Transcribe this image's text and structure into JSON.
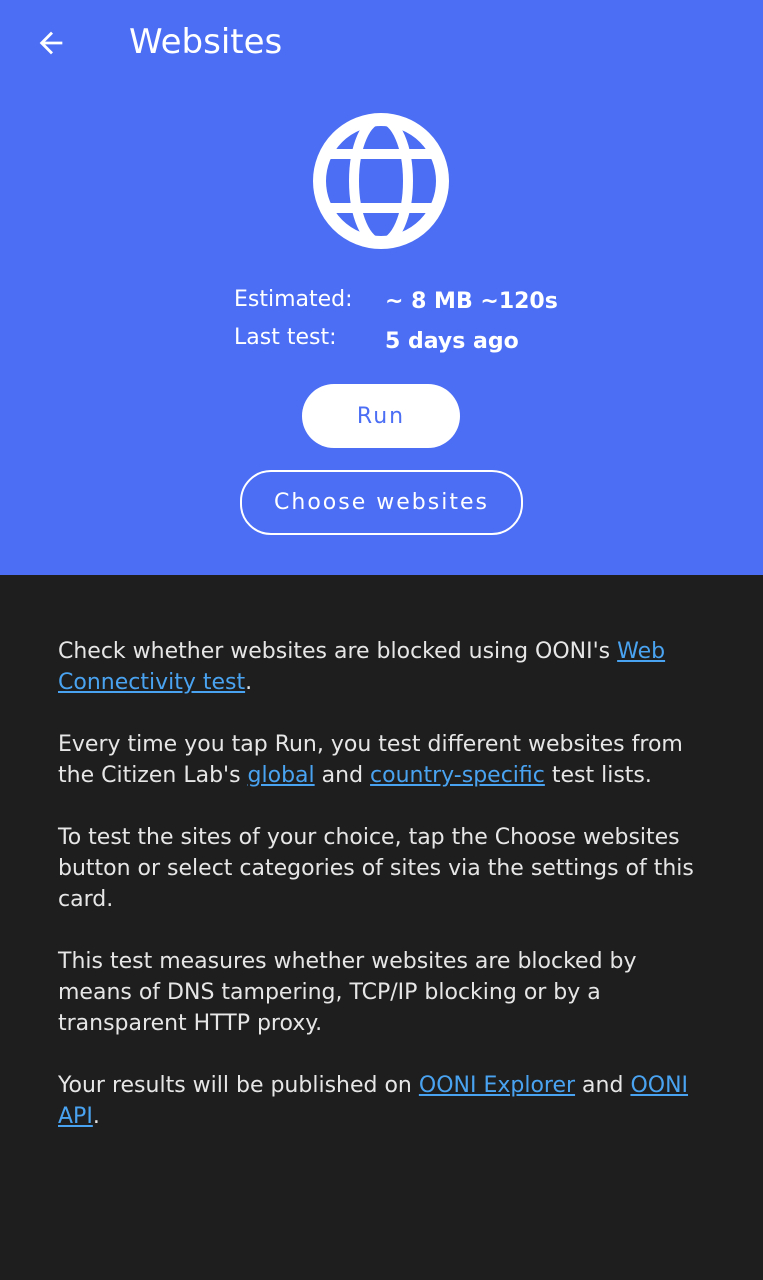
{
  "header": {
    "title": "Websites",
    "back_icon": "arrow-left-icon",
    "test_icon": "globe-icon",
    "background_color": "#4b6ef5"
  },
  "meta": {
    "estimated_label": "Estimated:",
    "estimated_value": "~ 8 MB ~120s",
    "last_test_label": "Last test:",
    "last_test_value": "5 days ago"
  },
  "buttons": {
    "run_label": "Run",
    "choose_websites_label": "Choose websites"
  },
  "description": {
    "p1_text1": "Check whether websites are blocked using OONI's ",
    "p1_link": "Web Connectivity test",
    "p1_text2": ".",
    "p2_text1": "Every time you tap Run, you test different websites from the Citizen Lab's ",
    "p2_link1": "global",
    "p2_text2": " and ",
    "p2_link2": "country-specific",
    "p2_text3": " test lists.",
    "p3_text": "To test the sites of your choice, tap the Choose websites button or select categories of sites via the settings of this card.",
    "p4_text": "This test measures whether websites are blocked by means of DNS tampering, TCP/IP blocking or by a transparent HTTP proxy.",
    "p5_text1": "Your results will be published on ",
    "p5_link1": "OONI Explorer",
    "p5_text2": " and ",
    "p5_link2": "OONI API",
    "p5_text3": "."
  },
  "colors": {
    "link": "#4aa3f0",
    "body_background": "#1e1e1e"
  }
}
